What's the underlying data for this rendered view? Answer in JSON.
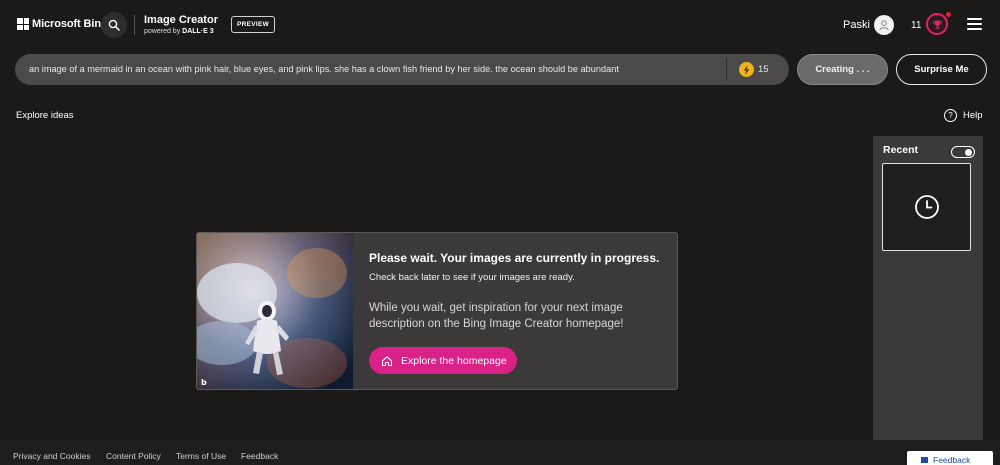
{
  "header": {
    "brand": "Microsoft Bing",
    "app_title": "Image Creator",
    "app_sub_prefix": "powered by ",
    "app_sub_model": "DALL·E 3",
    "preview_badge": "PREVIEW",
    "username": "Paski",
    "rewards_count": "11"
  },
  "prompt": {
    "text": "an image of a mermaid in an ocean with pink hair, blue eyes, and pink lips. she has a clown fish friend by her side. the ocean should be abundant",
    "boosts": "15",
    "create_label": "Creating . . .",
    "surprise_label": "Surprise Me"
  },
  "explore_ideas": "Explore ideas",
  "help_label": "Help",
  "recent": {
    "label": "Recent",
    "toggle_on": true
  },
  "wait_card": {
    "title": "Please wait. Your images are currently in progress.",
    "subtitle": "Check back later to see if your images are ready.",
    "body": "While you wait, get inspiration for your next image description on the Bing Image Creator homepage!",
    "button_label": "Explore the homepage",
    "image_watermark": "b"
  },
  "footer": {
    "links": [
      "Privacy and Cookies",
      "Content Policy",
      "Terms of Use",
      "Feedback"
    ],
    "feedback_button": "Feedback"
  },
  "colors": {
    "background": "#1b1a19",
    "accent_pink": "#d92188",
    "rewards_pink": "#e81e63",
    "boost_gold": "#f2b31b"
  },
  "icons": [
    "microsoft-logo-icon",
    "search-icon",
    "user-avatar-icon",
    "trophy-icon",
    "hamburger-menu-icon",
    "boost-icon",
    "help-icon",
    "clock-icon",
    "home-icon",
    "feedback-icon"
  ]
}
